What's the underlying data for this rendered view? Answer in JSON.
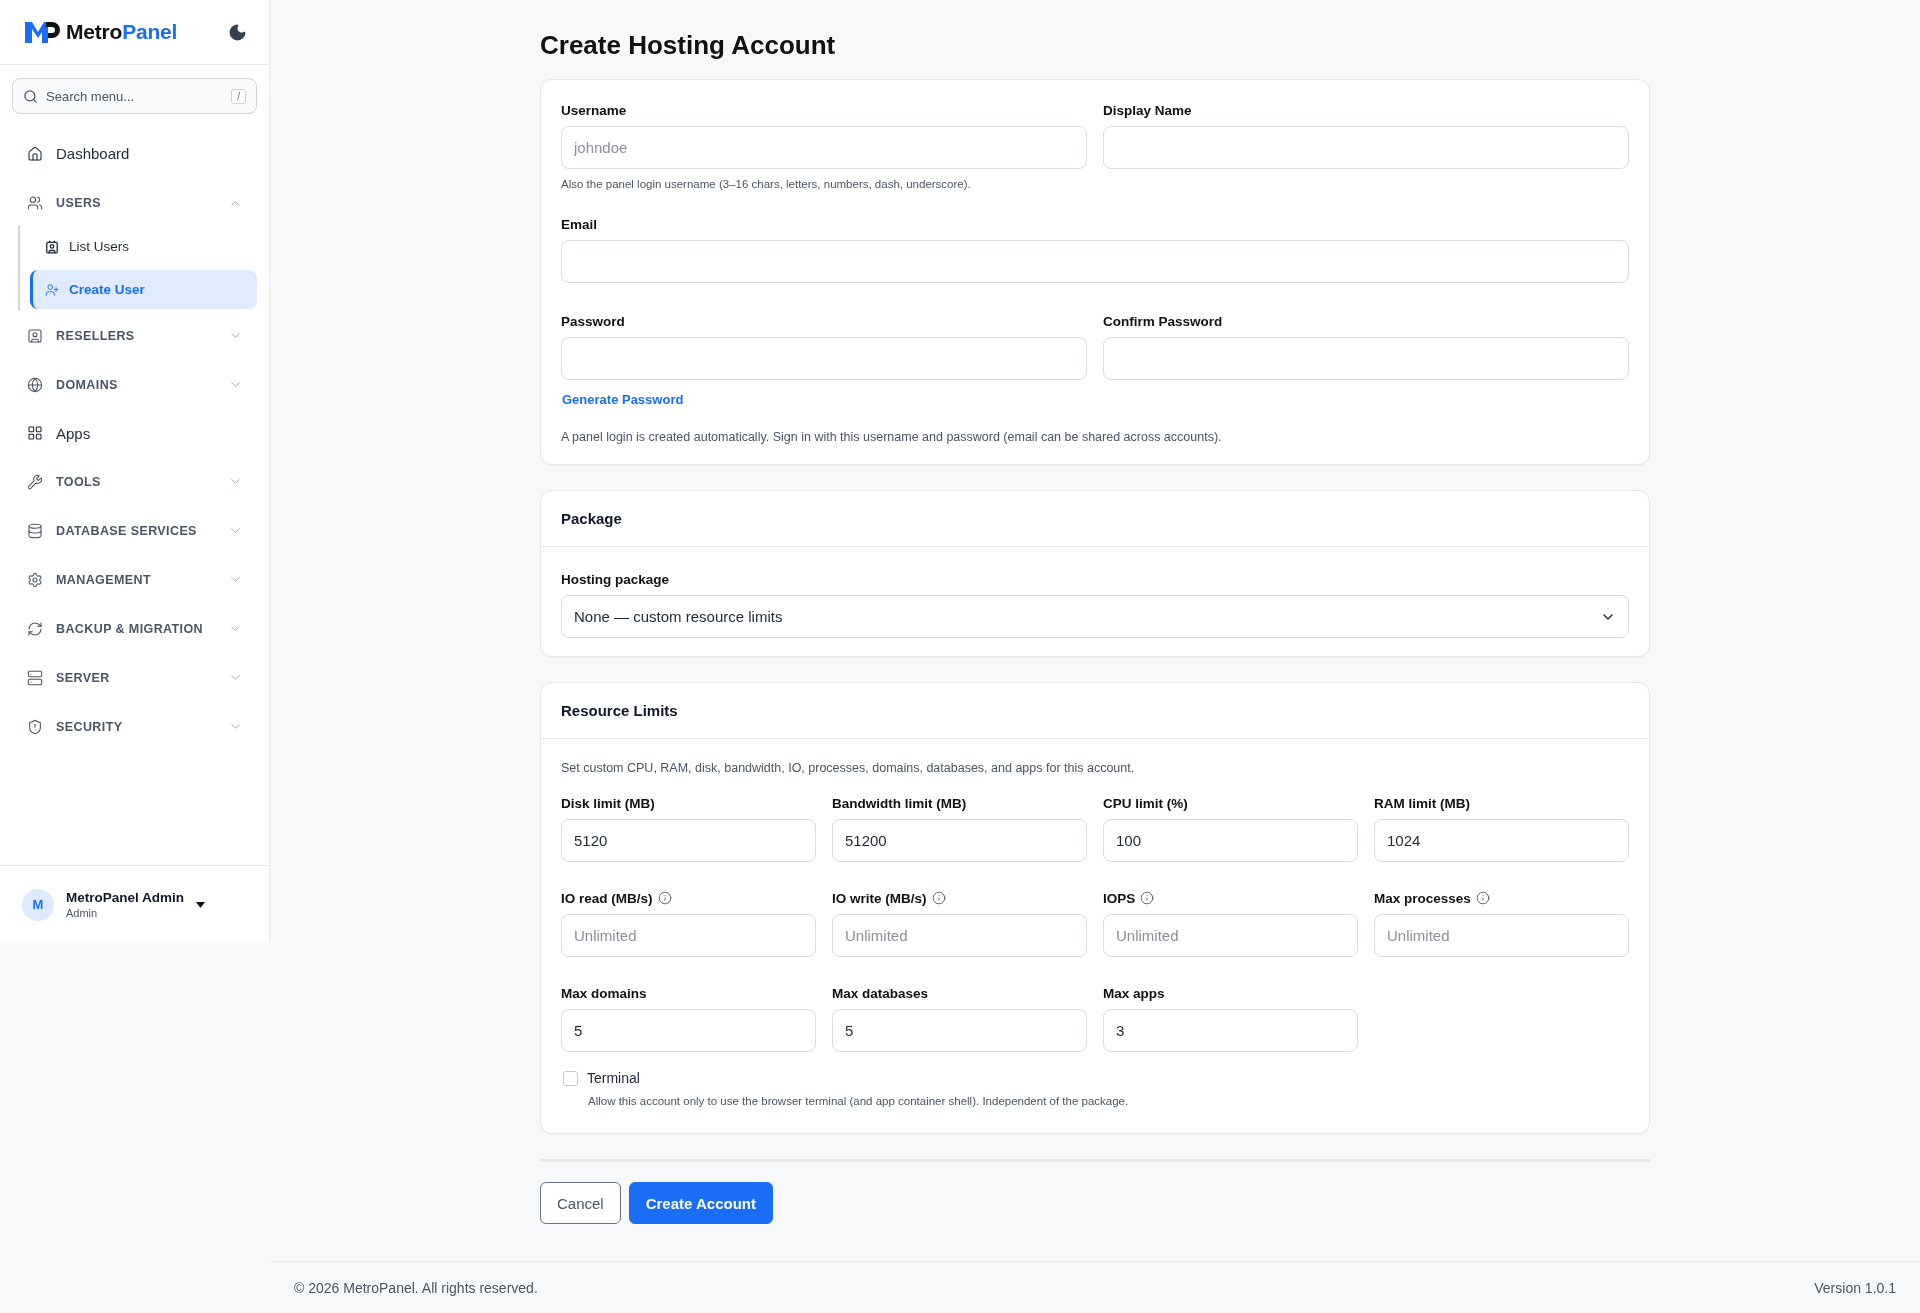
{
  "sidebar": {
    "brand": {
      "name": "Metro",
      "accent": "Panel"
    },
    "search": {
      "placeholder": "Search menu...",
      "shortcut": "/"
    },
    "nav": [
      {
        "kind": "link",
        "label": "Dashboard"
      },
      {
        "kind": "group",
        "label": "USERS",
        "expanded": true,
        "children": [
          {
            "label": "List Users",
            "selected": false
          },
          {
            "label": "Create User",
            "selected": true
          }
        ]
      },
      {
        "kind": "group",
        "label": "RESELLERS",
        "expanded": false
      },
      {
        "kind": "group",
        "label": "DOMAINS",
        "expanded": false
      },
      {
        "kind": "link",
        "label": "Apps"
      },
      {
        "kind": "group",
        "label": "TOOLS",
        "expanded": false
      },
      {
        "kind": "group",
        "label": "DATABASE SERVICES",
        "expanded": false
      },
      {
        "kind": "group",
        "label": "MANAGEMENT",
        "expanded": false
      },
      {
        "kind": "group",
        "label": "BACKUP & MIGRATION",
        "expanded": false
      },
      {
        "kind": "group",
        "label": "SERVER",
        "expanded": false
      },
      {
        "kind": "group",
        "label": "SECURITY",
        "expanded": false
      }
    ],
    "user": {
      "initial": "M",
      "name": "MetroPanel Admin",
      "role": "Admin"
    }
  },
  "page": {
    "title": "Create Hosting Account"
  },
  "account": {
    "username": {
      "label": "Username",
      "placeholder": "johndoe",
      "hint": "Also the panel login username (3–16 chars, letters, numbers, dash, underscore)."
    },
    "display_name": {
      "label": "Display Name"
    },
    "email": {
      "label": "Email"
    },
    "password": {
      "label": "Password"
    },
    "confirm_password": {
      "label": "Confirm Password"
    },
    "generate_link": "Generate Password",
    "note": "A panel login is created automatically. Sign in with this username and password (email can be shared across accounts)."
  },
  "package": {
    "title": "Package",
    "label": "Hosting package",
    "value": "None — custom resource limits"
  },
  "resources": {
    "title": "Resource Limits",
    "description": "Set custom CPU, RAM, disk, bandwidth, IO, processes, domains, databases, and apps for this account.",
    "fields": [
      {
        "label": "Disk limit (MB)",
        "value": "5120",
        "info": false
      },
      {
        "label": "Bandwidth limit (MB)",
        "value": "51200",
        "info": false
      },
      {
        "label": "CPU limit (%)",
        "value": "100",
        "info": false
      },
      {
        "label": "RAM limit (MB)",
        "value": "1024",
        "info": false
      },
      {
        "label": "IO read (MB/s)",
        "placeholder": "Unlimited",
        "info": true
      },
      {
        "label": "IO write (MB/s)",
        "placeholder": "Unlimited",
        "info": true
      },
      {
        "label": "IOPS",
        "placeholder": "Unlimited",
        "info": true
      },
      {
        "label": "Max processes",
        "placeholder": "Unlimited",
        "info": true
      },
      {
        "label": "Max domains",
        "value": "5",
        "info": false
      },
      {
        "label": "Max databases",
        "value": "5",
        "info": false
      },
      {
        "label": "Max apps",
        "value": "3",
        "info": false
      }
    ],
    "terminal": {
      "label": "Terminal",
      "checked": false,
      "description": "Allow this account only to use the browser terminal (and app container shell). Independent of the package."
    }
  },
  "actions": {
    "cancel": "Cancel",
    "submit": "Create Account"
  },
  "footer": {
    "copyright": "© 2026 MetroPanel. All rights reserved.",
    "version": "Version 1.0.1"
  }
}
